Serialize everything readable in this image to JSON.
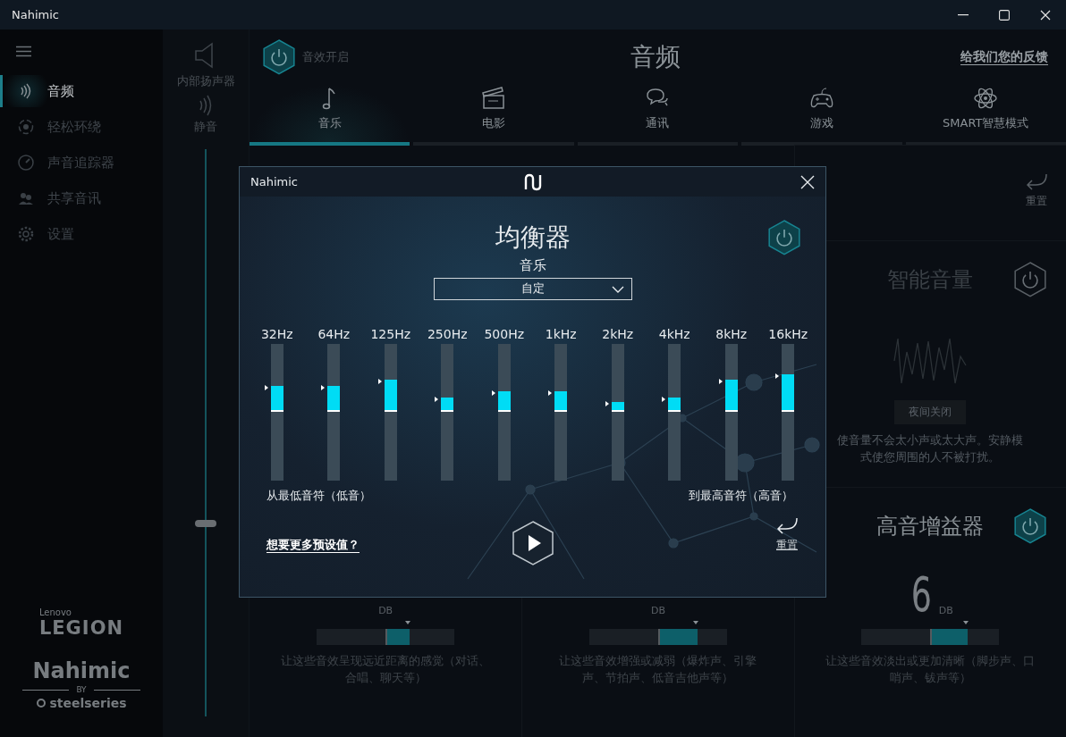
{
  "window": {
    "title": "Nahimic"
  },
  "sidebar": {
    "items": [
      {
        "label": "音频",
        "selected": true
      },
      {
        "label": "轻松环绕",
        "selected": false
      },
      {
        "label": "声音追踪器",
        "selected": false
      },
      {
        "label": "共享音讯",
        "selected": false
      },
      {
        "label": "设置",
        "selected": false
      }
    ],
    "legion_logo": {
      "brand": "Lenovo",
      "name": "LEGION"
    },
    "nahimic_logo": {
      "name": "Nahimic",
      "by": "BY",
      "maker": "steelseries"
    }
  },
  "output": {
    "device": "内部扬声器",
    "mute": "静音",
    "level": 0.34
  },
  "header": {
    "effects": {
      "label": "音效开启",
      "on": true
    },
    "title": "音频",
    "feedback_link": "给我们您的反馈"
  },
  "tabs": [
    {
      "label": "音乐",
      "selected": true
    },
    {
      "label": "电影",
      "selected": false
    },
    {
      "label": "通讯",
      "selected": false
    },
    {
      "label": "游戏",
      "selected": false
    },
    {
      "label": "SMART智慧模式",
      "selected": false
    }
  ],
  "reset": {
    "label": "重置"
  },
  "smart_volume": {
    "title": "智能音量",
    "on": false,
    "button": "夜间关闭",
    "description": "使音量不会太小声或太大声。安静模式使您周围的人不被打扰。"
  },
  "cards": [
    {
      "unit": "DB",
      "level": 0.66,
      "description": "让这些音效呈现远近距离的感觉（对话、合唱、聊天等）"
    },
    {
      "unit": "DB",
      "level": 0.77,
      "description": "让这些音效增强或减弱（爆炸声、引擎声、节拍声、低音吉他声等）"
    },
    {
      "title": "高音增益器",
      "on": true,
      "value": "6",
      "unit": "DB",
      "level": 0.76,
      "description": "让这些音效淡出或更加清晰（脚步声、口哨声、钹声等）"
    }
  ],
  "equalizer": {
    "title": "Nahimic",
    "heading": "均衡器",
    "on": true,
    "mode": "音乐",
    "preset": "自定",
    "bands": [
      {
        "label": "32Hz",
        "level": 0.68
      },
      {
        "label": "64Hz",
        "level": 0.68
      },
      {
        "label": "125Hz",
        "level": 0.72
      },
      {
        "label": "250Hz",
        "level": 0.59
      },
      {
        "label": "500Hz",
        "level": 0.64
      },
      {
        "label": "1kHz",
        "level": 0.64
      },
      {
        "label": "2kHz",
        "level": 0.56
      },
      {
        "label": "4kHz",
        "level": 0.59
      },
      {
        "label": "8kHz",
        "level": 0.72
      },
      {
        "label": "16kHz",
        "level": 0.76
      }
    ],
    "low_label": "从最低音符（低音）",
    "high_label": "到最高音符（高音）",
    "more_presets_link": "想要更多预设值？",
    "reset": "重置"
  }
}
